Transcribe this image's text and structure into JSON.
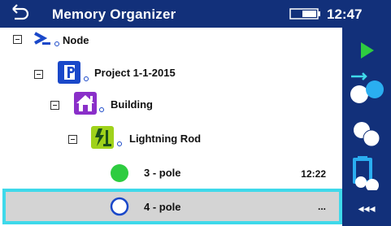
{
  "header": {
    "title": "Memory Organizer",
    "time": "12:47"
  },
  "tree": {
    "items": [
      {
        "label": "Node",
        "icon": "node-prompt-icon",
        "level": 0
      },
      {
        "label": "Project 1-1-2015",
        "icon": "project-icon",
        "level": 1
      },
      {
        "label": "Building",
        "icon": "building-icon",
        "level": 2
      },
      {
        "label": "Lightning Rod",
        "icon": "lightning-rod-icon",
        "level": 3
      },
      {
        "label": "3 - pole",
        "icon": "measurement-done-icon",
        "level": 4,
        "time": "12:22"
      },
      {
        "label": "4 - pole",
        "icon": "measurement-empty-icon",
        "level": 4,
        "time": "...",
        "selected": true
      }
    ]
  },
  "sidebar": {
    "buttons": [
      {
        "name": "start",
        "icon": "play-icon"
      },
      {
        "name": "add-structure",
        "icon": "add-structure-icon"
      },
      {
        "name": "clone",
        "icon": "clone-icon"
      },
      {
        "name": "paste",
        "icon": "clipboard-icon"
      }
    ],
    "more_label": "◂◂◂"
  },
  "colors": {
    "header_bg": "#12307a",
    "selection_border": "#3fd9ea",
    "selection_bg": "#d4d4d4",
    "accent_green": "#2ecc40",
    "accent_blue": "#1a48c9"
  }
}
